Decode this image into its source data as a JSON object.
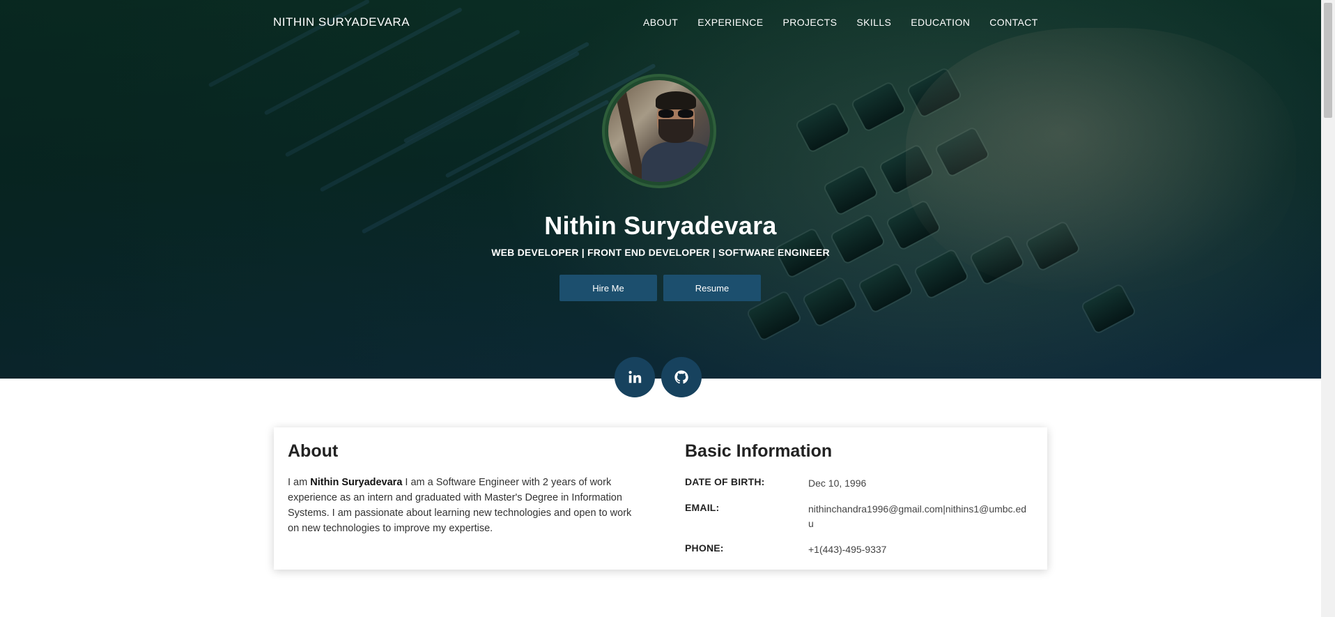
{
  "brand": "NITHIN SURYADEVARA",
  "nav": [
    {
      "label": "ABOUT"
    },
    {
      "label": "EXPERIENCE"
    },
    {
      "label": "PROJECTS"
    },
    {
      "label": "SKILLS"
    },
    {
      "label": "EDUCATION"
    },
    {
      "label": "CONTACT"
    }
  ],
  "hero": {
    "name": "Nithin Suryadevara",
    "subtitle": "WEB DEVELOPER | FRONT END DEVELOPER | SOFTWARE ENGINEER",
    "hire_label": "Hire Me",
    "resume_label": "Resume"
  },
  "social": [
    {
      "icon": "linkedin-icon"
    },
    {
      "icon": "github-icon"
    }
  ],
  "about": {
    "title": "About",
    "prefix": "I am ",
    "name": "Nithin Suryadevara",
    "text": " I am a Software Engineer with 2 years of work experience as an intern and graduated with Master's Degree in Information Systems. I am passionate about learning new technologies and open to work on new technologies to improve my expertise."
  },
  "basic_info": {
    "title": "Basic Information",
    "rows": [
      {
        "label": "DATE OF BIRTH:",
        "value": "Dec 10, 1996"
      },
      {
        "label": "EMAIL:",
        "value": "nithinchandra1996@gmail.com|nithins1@umbc.edu"
      },
      {
        "label": "PHONE:",
        "value": "+1(443)-495-9337"
      }
    ]
  },
  "colors": {
    "button": "#1c4f6e",
    "social": "#17425e",
    "avatar_ring": "#2e5e3a"
  }
}
